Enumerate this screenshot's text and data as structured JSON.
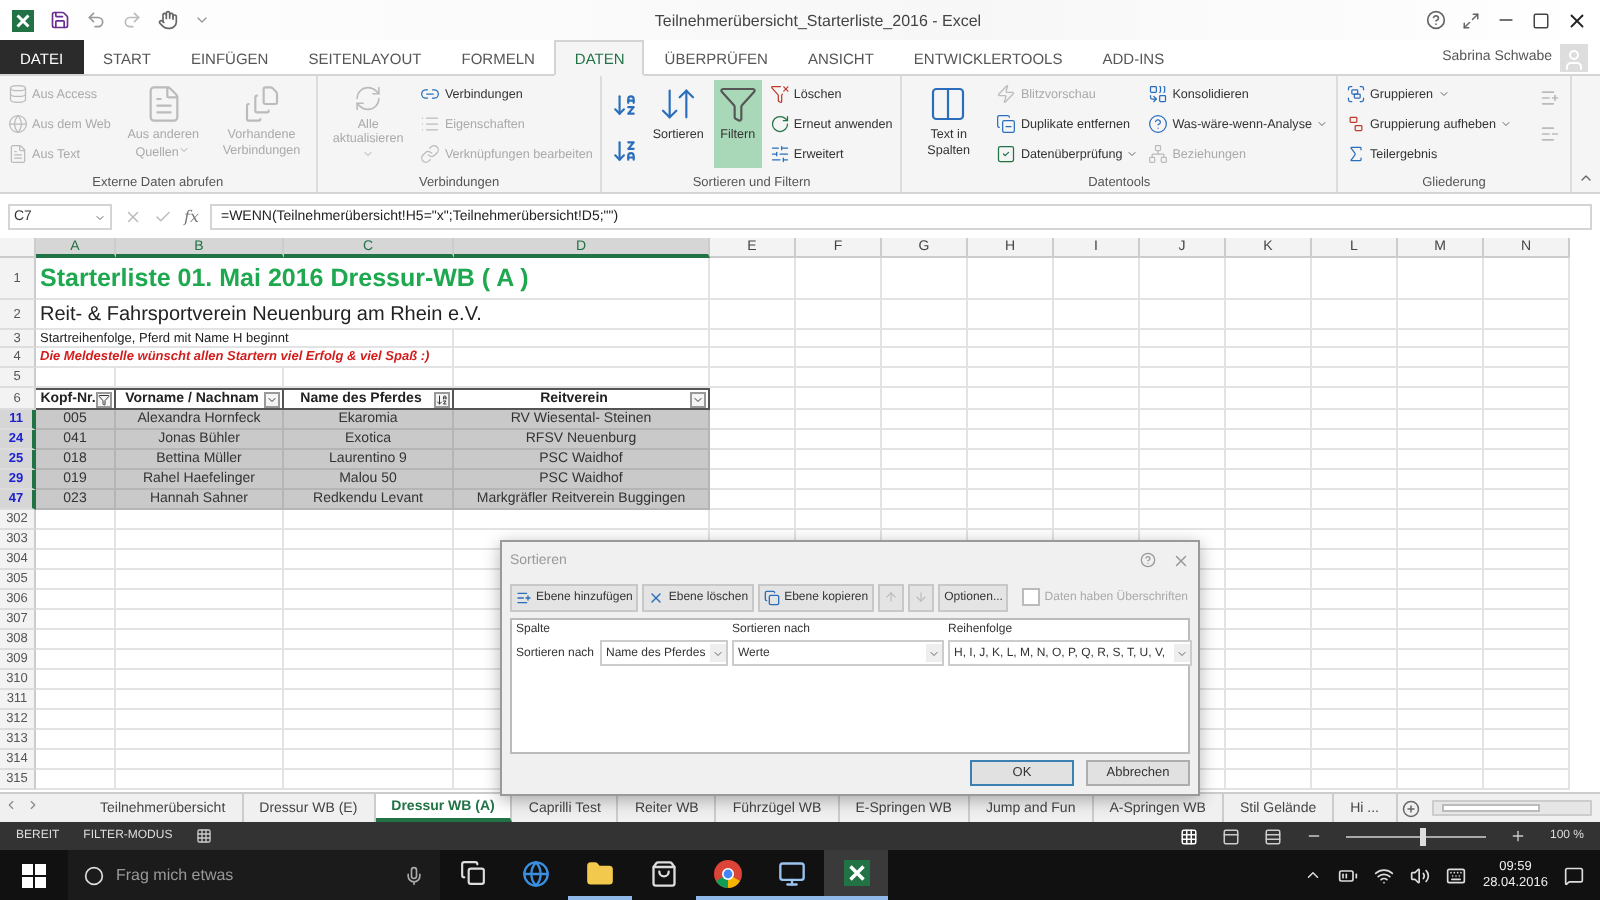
{
  "window": {
    "title": "Teilnehmerübersicht_Starterliste_2016 - Excel",
    "user": "Sabrina Schwabe"
  },
  "tabs": [
    {
      "label": "DATEI",
      "kind": "file",
      "selected": false
    },
    {
      "label": "START",
      "kind": "tab",
      "selected": false
    },
    {
      "label": "EINFÜGEN",
      "kind": "tab",
      "selected": false
    },
    {
      "label": "SEITENLAYOUT",
      "kind": "tab",
      "selected": false
    },
    {
      "label": "FORMELN",
      "kind": "tab",
      "selected": false
    },
    {
      "label": "DATEN",
      "kind": "tab",
      "selected": true
    },
    {
      "label": "ÜBERPRÜFEN",
      "kind": "tab",
      "selected": false
    },
    {
      "label": "ANSICHT",
      "kind": "tab",
      "selected": false
    },
    {
      "label": "ENTWICKLERTOOLS",
      "kind": "tab",
      "selected": false
    },
    {
      "label": "ADD-INS",
      "kind": "tab",
      "selected": false
    }
  ],
  "ribbon": {
    "groups": [
      {
        "label": "Externe Daten abrufen",
        "columns": [
          {
            "kind": "stack",
            "items": [
              {
                "label": "Aus Access",
                "disabled": true,
                "menu": false
              },
              {
                "label": "Aus dem Web",
                "disabled": true,
                "menu": false
              },
              {
                "label": "Aus Text",
                "disabled": true,
                "menu": false
              }
            ]
          },
          {
            "kind": "large",
            "label": "Aus anderen Quellen",
            "disabled": true,
            "menu": true,
            "on": false
          },
          {
            "kind": "large",
            "label": "Vorhandene Verbindungen",
            "disabled": true,
            "menu": false,
            "on": false
          }
        ]
      },
      {
        "label": "Verbindungen",
        "columns": [
          {
            "kind": "large",
            "label": "Alle aktualisieren",
            "disabled": true,
            "menu": true,
            "on": false
          },
          {
            "kind": "stack",
            "items": [
              {
                "label": "Verbindungen",
                "disabled": false,
                "menu": false
              },
              {
                "label": "Eigenschaften",
                "disabled": true,
                "menu": false
              },
              {
                "label": "Verknüpfungen bearbeiten",
                "disabled": true,
                "menu": false
              }
            ]
          }
        ]
      },
      {
        "label": "Sortieren und Filtern",
        "columns": [
          {
            "kind": "sort-stack"
          },
          {
            "kind": "large",
            "label": "Sortieren",
            "disabled": false,
            "menu": false,
            "on": false
          },
          {
            "kind": "large",
            "label": "Filtern",
            "disabled": false,
            "menu": false,
            "on": true
          },
          {
            "kind": "stack",
            "items": [
              {
                "label": "Löschen",
                "disabled": false,
                "menu": false
              },
              {
                "label": "Erneut anwenden",
                "disabled": false,
                "menu": false
              },
              {
                "label": "Erweitert",
                "disabled": false,
                "menu": false
              }
            ]
          }
        ]
      },
      {
        "label": "Datentools",
        "columns": [
          {
            "kind": "large",
            "label": "Text in Spalten",
            "disabled": false,
            "menu": false,
            "on": false
          },
          {
            "kind": "stack",
            "items": [
              {
                "label": "Blitzvorschau",
                "disabled": true,
                "menu": false
              },
              {
                "label": "Duplikate entfernen",
                "disabled": false,
                "menu": false
              },
              {
                "label": "Datenüberprüfung",
                "disabled": false,
                "menu": true
              }
            ]
          },
          {
            "kind": "stack",
            "items": [
              {
                "label": "Konsolidieren",
                "disabled": false,
                "menu": false
              },
              {
                "label": "Was-wäre-wenn-Analyse",
                "disabled": false,
                "menu": true
              },
              {
                "label": "Beziehungen",
                "disabled": true,
                "menu": false
              }
            ]
          }
        ]
      },
      {
        "label": "Gliederung",
        "columns": [
          {
            "kind": "stack",
            "items": [
              {
                "label": "Gruppieren",
                "disabled": false,
                "menu": true
              },
              {
                "label": "Gruppierung aufheben",
                "disabled": false,
                "menu": true
              },
              {
                "label": "Teilergebnis",
                "disabled": false,
                "menu": false
              }
            ]
          },
          {
            "kind": "detail-stack"
          }
        ]
      }
    ]
  },
  "formula_bar": {
    "name_box": "C7",
    "fx": "fx",
    "formula": "=WENN(Teilnehmerübersicht!H5=\"x\";Teilnehmerübersicht!D5;\"\")"
  },
  "sheet": {
    "columns": [
      {
        "label": "A",
        "selected": true
      },
      {
        "label": "B",
        "selected": true
      },
      {
        "label": "C",
        "selected": true
      },
      {
        "label": "D",
        "selected": true
      },
      {
        "label": "E",
        "selected": false
      },
      {
        "label": "F",
        "selected": false
      },
      {
        "label": "G",
        "selected": false
      },
      {
        "label": "H",
        "selected": false
      },
      {
        "label": "I",
        "selected": false
      },
      {
        "label": "J",
        "selected": false
      },
      {
        "label": "K",
        "selected": false
      },
      {
        "label": "L",
        "selected": false
      },
      {
        "label": "M",
        "selected": false
      },
      {
        "label": "N",
        "selected": false
      }
    ],
    "rows": [
      {
        "number": "1",
        "kind": "title",
        "text": "Starterliste 01. Mai 2016 Dressur-WB ( A )"
      },
      {
        "number": "2",
        "kind": "subtitle",
        "text": "Reit- & Fahrsportverein Neuenburg am Rhein e.V."
      },
      {
        "number": "3",
        "kind": "note",
        "text": "Startreihenfolge, Pferd mit Name H beginnt"
      },
      {
        "number": "4",
        "kind": "notice",
        "text": "Die Meldestelle wünscht allen Startern viel Erfolg & viel Spaß :)"
      },
      {
        "number": "5",
        "kind": "empty"
      },
      {
        "number": "6",
        "kind": "header",
        "cells": [
          {
            "text": "Kopf-Nr.",
            "kind": "filtered"
          },
          {
            "text": "Vorname / Nachnam",
            "kind": "plain"
          },
          {
            "text": "Name des Pferdes",
            "kind": "sorted"
          },
          {
            "text": "Reitverein",
            "kind": "plain"
          }
        ]
      },
      {
        "number": "11",
        "kind": "data",
        "filtered": true,
        "selected": true,
        "cells": [
          "005",
          "Alexandra Hornfeck",
          "Ekaromia",
          "RV Wiesental- Steinen"
        ]
      },
      {
        "number": "24",
        "kind": "data",
        "filtered": true,
        "selected": true,
        "cells": [
          "041",
          "Jonas Bühler",
          "Exotica",
          "RFSV Neuenburg"
        ]
      },
      {
        "number": "25",
        "kind": "data",
        "filtered": true,
        "selected": true,
        "cells": [
          "018",
          "Bettina Müller",
          "Laurentino 9",
          "PSC Waidhof"
        ]
      },
      {
        "number": "29",
        "kind": "data",
        "filtered": true,
        "selected": true,
        "cells": [
          "019",
          "Rahel Haefelinger",
          "Malou 50",
          "PSC Waidhof"
        ]
      },
      {
        "number": "47",
        "kind": "data",
        "filtered": true,
        "selected": true,
        "cells": [
          "023",
          "Hannah Sahner",
          "Redkendu Levant",
          "Markgräfler Reitverein Buggingen"
        ]
      },
      {
        "number": "302",
        "kind": "empty"
      },
      {
        "number": "303",
        "kind": "empty"
      },
      {
        "number": "304",
        "kind": "empty"
      },
      {
        "number": "305",
        "kind": "empty"
      },
      {
        "number": "306",
        "kind": "empty"
      },
      {
        "number": "307",
        "kind": "empty"
      },
      {
        "number": "308",
        "kind": "empty"
      },
      {
        "number": "309",
        "kind": "empty"
      },
      {
        "number": "310",
        "kind": "empty"
      },
      {
        "number": "311",
        "kind": "empty"
      },
      {
        "number": "312",
        "kind": "empty"
      },
      {
        "number": "313",
        "kind": "empty"
      },
      {
        "number": "314",
        "kind": "empty"
      },
      {
        "number": "315",
        "kind": "empty"
      }
    ]
  },
  "sort_dialog": {
    "title": "Sortieren",
    "toolbar": [
      {
        "kind": "button",
        "label": "Ebene hinzufügen",
        "disabled": false
      },
      {
        "kind": "button",
        "label": "Ebene löschen",
        "disabled": false
      },
      {
        "kind": "button",
        "label": "Ebene kopieren",
        "disabled": false
      },
      {
        "kind": "arrow-up",
        "disabled": true
      },
      {
        "kind": "arrow-down",
        "disabled": true
      },
      {
        "kind": "options",
        "label": "Optionen...",
        "disabled": false
      }
    ],
    "headers_checkbox": {
      "label": "Daten haben Überschriften",
      "checked": false,
      "disabled": true
    },
    "columns": [
      "Spalte",
      "Sortieren nach",
      "Reihenfolge"
    ],
    "levels": [
      {
        "label": "Sortieren nach",
        "column": "Name des Pferdes",
        "sort_on": "Werte",
        "order": "H, I, J, K, L, M, N, O, P, Q, R, S, T, U, V,"
      }
    ],
    "buttons": [
      {
        "label": "OK",
        "kind": "default"
      },
      {
        "label": "Abbrechen",
        "kind": "cancel"
      }
    ]
  },
  "sheet_tabs": [
    {
      "label": "Teilnehmerübersicht",
      "selected": false
    },
    {
      "label": "Dressur WB (E)",
      "selected": false
    },
    {
      "label": "Dressur WB (A)",
      "selected": true
    },
    {
      "label": "Caprilli Test",
      "selected": false
    },
    {
      "label": "Reiter WB",
      "selected": false
    },
    {
      "label": "Führzügel WB",
      "selected": false
    },
    {
      "label": "E-Springen WB",
      "selected": false
    },
    {
      "label": "Jump and Fun",
      "selected": false
    },
    {
      "label": "A-Springen WB",
      "selected": false
    },
    {
      "label": "Stil Gelände",
      "selected": false
    },
    {
      "label": "Hi ...",
      "selected": false
    }
  ],
  "status_bar": {
    "items": [
      "BEREIT",
      "FILTER-MODUS"
    ],
    "zoom": {
      "level": 0.55,
      "reading": "100 %"
    }
  },
  "taskbar": {
    "search": {
      "placeholder": "Frag mich etwas"
    },
    "apps": [
      {
        "kind": "task-view",
        "running": false,
        "selected": false
      },
      {
        "kind": "edge",
        "running": false,
        "selected": false
      },
      {
        "kind": "explorer",
        "running": true,
        "selected": false
      },
      {
        "kind": "store",
        "running": false,
        "selected": false
      },
      {
        "kind": "chrome",
        "running": true,
        "selected": false
      },
      {
        "kind": "remote",
        "running": true,
        "selected": false
      },
      {
        "kind": "excel",
        "running": true,
        "selected": true
      }
    ],
    "time": "09:59",
    "date": "28.04.2016"
  }
}
